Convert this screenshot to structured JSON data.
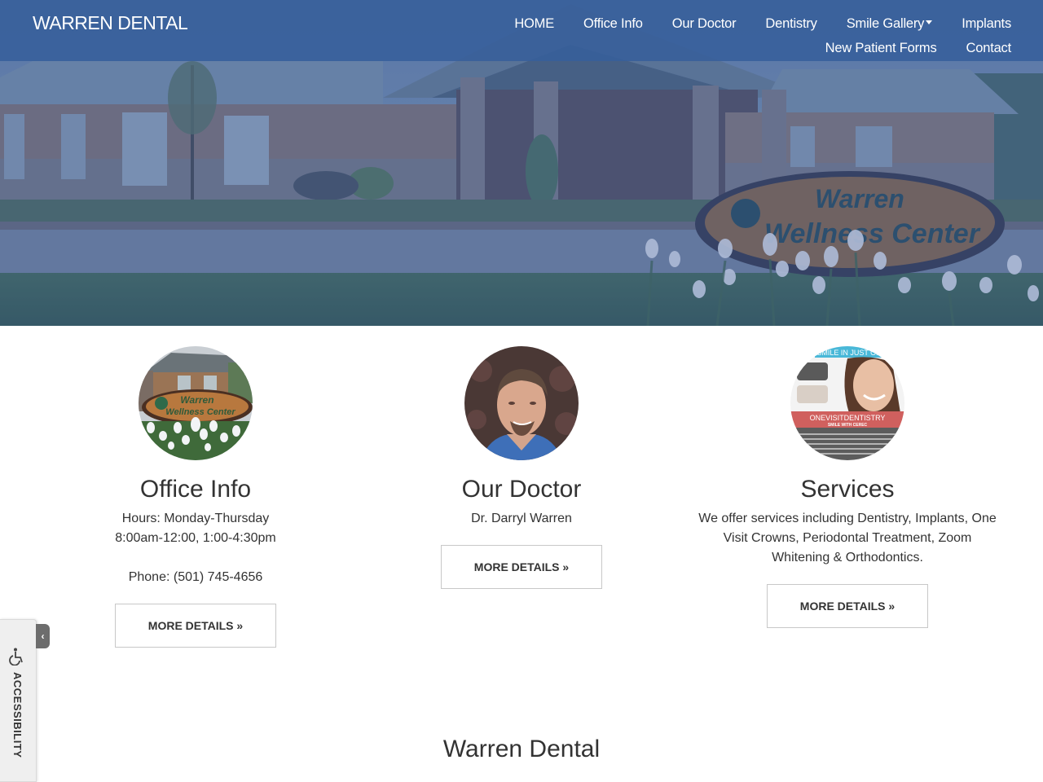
{
  "header": {
    "brand": "WARREN DENTAL",
    "nav": {
      "row1": [
        {
          "label": "HOME"
        },
        {
          "label": "Office Info"
        },
        {
          "label": "Our Doctor"
        },
        {
          "label": "Dentistry"
        },
        {
          "label": "Smile Gallery",
          "has_dropdown": true
        },
        {
          "label": "Implants"
        }
      ],
      "row2": [
        {
          "label": "New Patient Forms"
        },
        {
          "label": "Contact"
        }
      ]
    }
  },
  "hero": {
    "image": "warren-wellness-center-building-photo",
    "sign_text_line1": "Warren",
    "sign_text_line2": "Wellness Center",
    "overlay_color": "#2b5aa0"
  },
  "features": [
    {
      "image": "office-sign-photo",
      "title": "Office Info",
      "lines": [
        "Hours: Monday-Thursday",
        "8:00am-12:00, 1:00-4:30pm"
      ],
      "phone": "Phone: (501) 745-4656",
      "button": "MORE DETAILS »"
    },
    {
      "image": "doctor-portrait-photo",
      "title": "Our Doctor",
      "lines": [
        "Dr. Darryl Warren"
      ],
      "button": "MORE DETAILS »"
    },
    {
      "image": "cerec-one-visit-dentistry-ad",
      "title": "Services",
      "lines": [
        "We offer services including Dentistry, Implants, One Visit Crowns, Periodontal Treatment, Zoom Whitening & Orthodontics."
      ],
      "button": "MORE DETAILS »",
      "thumb_banner_top": "SMILE IN JUST ONE",
      "thumb_banner_mid": "ONEVISITDENTISTRY",
      "thumb_banner_sub": "SMILE WITH CEREC"
    }
  ],
  "section_title": "Warren Dental",
  "accessibility": {
    "label": "ACCESSIBILITY",
    "toggle": "‹"
  },
  "colors": {
    "navbar": "#375f9b",
    "text": "#333333",
    "button_border": "#c8c8c8",
    "cerec_banner": "#d0605e",
    "cerec_top_banner": "#49b8d8"
  }
}
